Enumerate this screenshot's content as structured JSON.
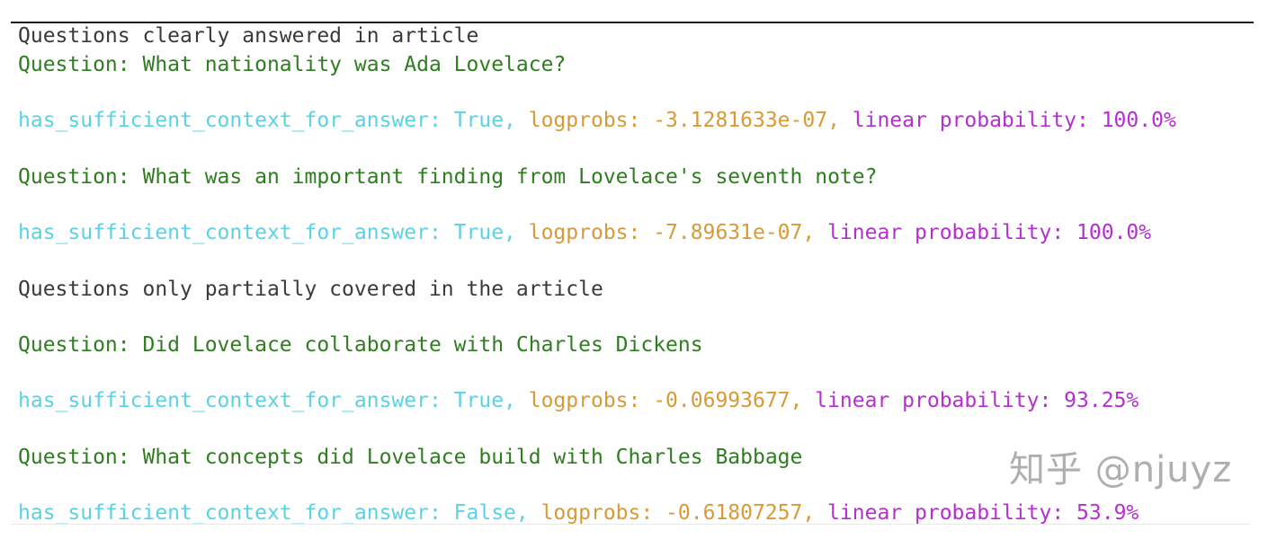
{
  "colors": {
    "heading": "#3a3a3a",
    "question": "#2e7d1f",
    "context": "#5ad2e6",
    "logprobs": "#d99a36",
    "probability": "#b52fd0",
    "watermark": "#8a8a8a"
  },
  "sections": [
    {
      "heading": "Questions clearly answered in article"
    },
    {
      "heading": "Questions only partially covered in the article"
    }
  ],
  "items": [
    {
      "question": "Question: What nationality was Ada Lovelace?",
      "context": "has_sufficient_context_for_answer: True,",
      "logprobs": " logprobs: -3.1281633e-07,",
      "probability": " linear probability: 100.0%"
    },
    {
      "question": "Question: What was an important finding from Lovelace's seventh note?",
      "context": "has_sufficient_context_for_answer: True,",
      "logprobs": " logprobs: -7.89631e-07,",
      "probability": " linear probability: 100.0%"
    },
    {
      "question": "Question: Did Lovelace collaborate with Charles Dickens",
      "context": "has_sufficient_context_for_answer: True,",
      "logprobs": " logprobs: -0.06993677,",
      "probability": " linear probability: 93.25%"
    },
    {
      "question": "Question: What concepts did Lovelace build with Charles Babbage",
      "context": "has_sufficient_context_for_answer: False,",
      "logprobs": " logprobs: -0.61807257,",
      "probability": " linear probability: 53.9%"
    }
  ],
  "watermark": "知乎 @njuyz"
}
